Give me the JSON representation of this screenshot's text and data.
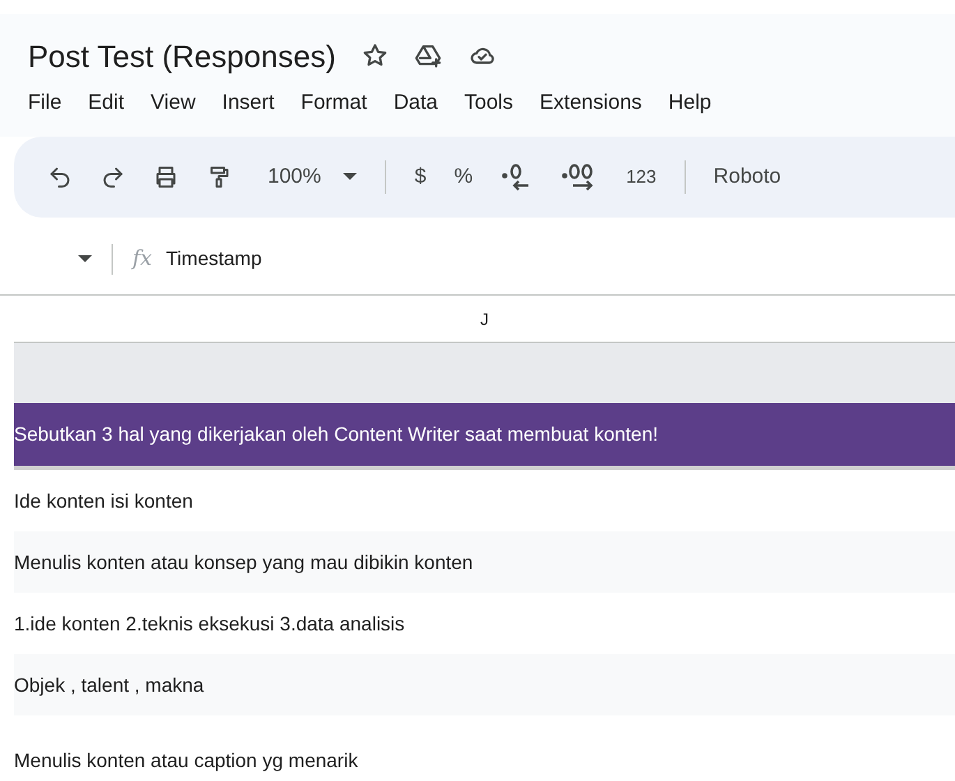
{
  "doc": {
    "title": "Post Test (Responses)"
  },
  "menu": [
    "File",
    "Edit",
    "View",
    "Insert",
    "Format",
    "Data",
    "Tools",
    "Extensions",
    "Help"
  ],
  "toolbar": {
    "zoom": "100%",
    "currency": "$",
    "percent": "%",
    "number_format": "123",
    "font": "Roboto"
  },
  "formula_bar": {
    "fx": "fx",
    "value": "Timestamp"
  },
  "column_header": "J",
  "header_cell": "Sebutkan 3 hal yang dikerjakan oleh Content Writer saat membuat konten!",
  "rows": [
    "Ide konten isi konten",
    "Menulis konten atau konsep yang mau dibikin konten",
    "1.ide konten 2.teknis eksekusi 3.data analisis",
    "Objek , talent , makna",
    "Menulis konten atau caption yg menarik"
  ]
}
